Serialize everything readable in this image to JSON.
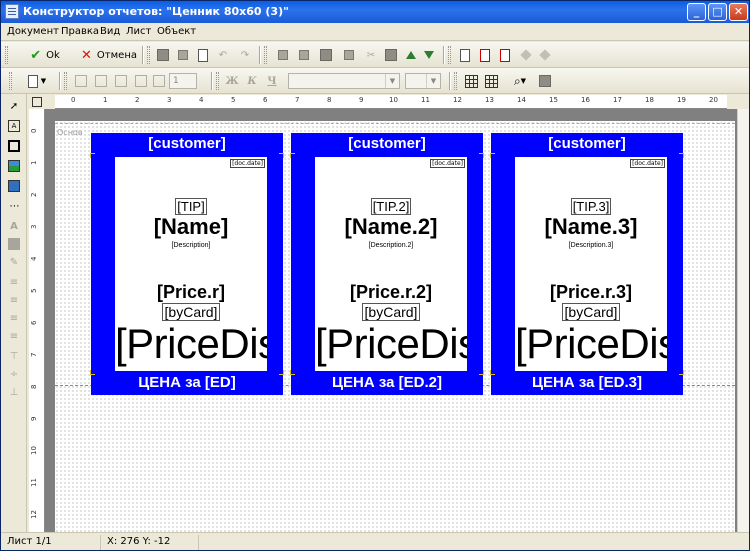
{
  "window": {
    "title": "Конструктор отчетов:  \"Ценник 80х60 (3)\"",
    "minimize_glyph": "_",
    "maximize_glyph": "□",
    "close_glyph": "✕"
  },
  "menu": {
    "items": [
      "Документ",
      "Правка",
      "Вид",
      "Лист",
      "Объект"
    ]
  },
  "toolbar1": {
    "ok_label": "Ok",
    "cancel_label": "Отмена"
  },
  "toolbar2": {
    "font_bold": "Ж",
    "font_italic": "К",
    "font_underline": "Ч",
    "line_width_value": "1"
  },
  "canvas": {
    "band_name": "Основ",
    "ruler_top": [
      "0",
      "1",
      "2",
      "3",
      "4",
      "5",
      "6",
      "7",
      "8",
      "9",
      "10",
      "11",
      "12",
      "13",
      "14",
      "15",
      "16",
      "17",
      "18",
      "19",
      "20"
    ],
    "ruler_left": [
      "0",
      "1",
      "2",
      "3",
      "4",
      "5",
      "6",
      "7",
      "8",
      "9",
      "10",
      "11",
      "12"
    ]
  },
  "tags": [
    {
      "customer": "[customer]",
      "doc_date": "[doc.date]",
      "tip": "[TIP]",
      "name": "[Name]",
      "description": "[Description]",
      "price": "[Price.r]",
      "bycard": "[byCard]",
      "pricedisc": "[PriceDis",
      "footer": "ЦЕНА за [ED]"
    },
    {
      "customer": "[customer]",
      "doc_date": "[doc.date]",
      "tip": "[TIP.2]",
      "name": "[Name.2]",
      "description": "[Description.2]",
      "price": "[Price.r.2]",
      "bycard": "[byCard]",
      "pricedisc": "[PriceDis",
      "footer": "ЦЕНА за [ED.2]"
    },
    {
      "customer": "[customer]",
      "doc_date": "[doc.date]",
      "tip": "[TIP.3]",
      "name": "[Name.3]",
      "description": "[Description.3]",
      "price": "[Price.r.3]",
      "bycard": "[byCard]",
      "pricedisc": "[PriceDis",
      "footer": "ЦЕНА за [ED.3]"
    }
  ],
  "status": {
    "sheet": "Лист 1/1",
    "coords": "X: 276  Y: -12"
  },
  "colors": {
    "tag_blue": "#0000ff",
    "titlebar": "#0a5ee0"
  }
}
